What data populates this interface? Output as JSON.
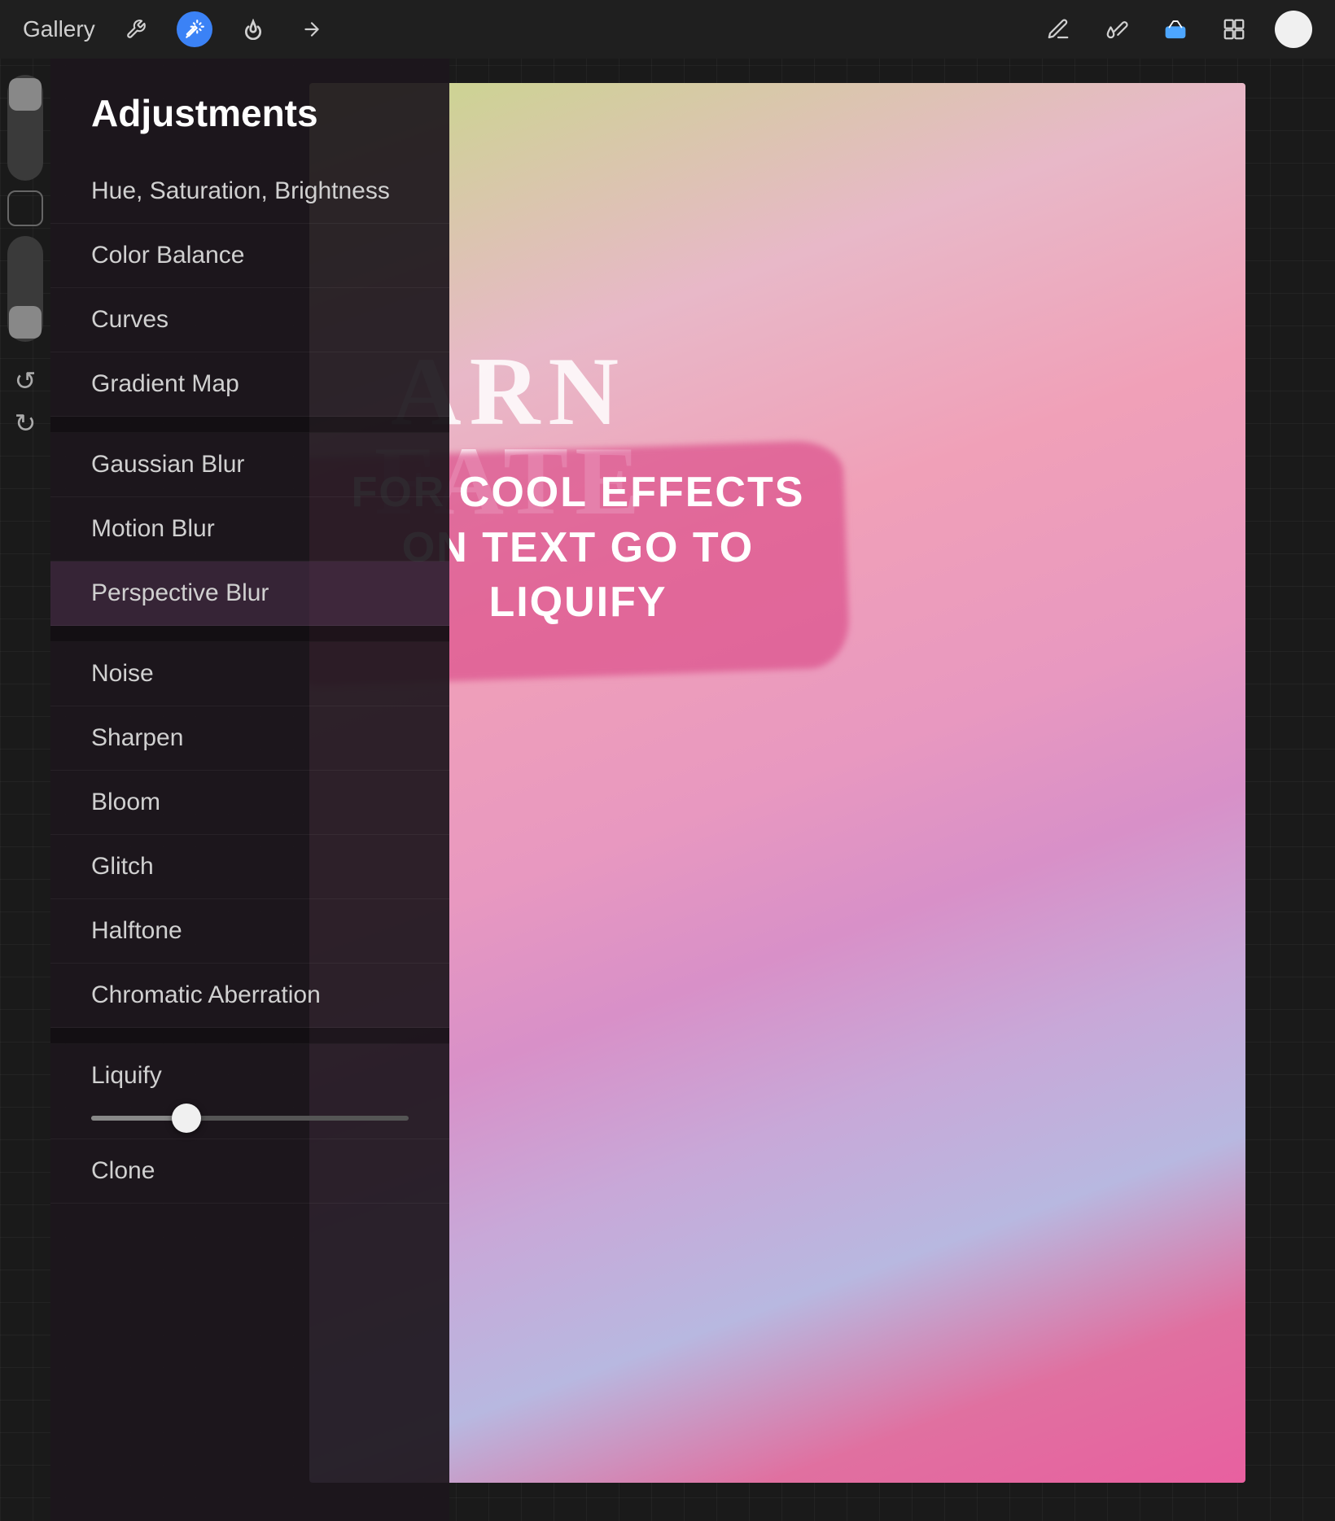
{
  "topBar": {
    "gallery": "Gallery",
    "icons": {
      "wrench": "wrench-icon",
      "magic": "magic-wand-icon",
      "style": "style-icon",
      "arrow": "arrow-icon"
    },
    "tools": {
      "pen": "pen-tool-icon",
      "brush": "brush-tool-icon",
      "eraser": "eraser-tool-icon",
      "layers": "layers-icon"
    }
  },
  "adjustments": {
    "title": "Adjustments",
    "items": [
      {
        "id": "hue-saturation",
        "label": "Hue, Saturation, Brightness",
        "section": "color"
      },
      {
        "id": "color-balance",
        "label": "Color Balance",
        "section": "color"
      },
      {
        "id": "curves",
        "label": "Curves",
        "section": "color"
      },
      {
        "id": "gradient-map",
        "label": "Gradient Map",
        "section": "color"
      },
      {
        "id": "gaussian-blur",
        "label": "Gaussian Blur",
        "section": "blur"
      },
      {
        "id": "motion-blur",
        "label": "Motion Blur",
        "section": "blur"
      },
      {
        "id": "perspective-blur",
        "label": "Perspective Blur",
        "section": "blur"
      },
      {
        "id": "noise",
        "label": "Noise",
        "section": "effects"
      },
      {
        "id": "sharpen",
        "label": "Sharpen",
        "section": "effects"
      },
      {
        "id": "bloom",
        "label": "Bloom",
        "section": "effects"
      },
      {
        "id": "glitch",
        "label": "Glitch",
        "section": "effects"
      },
      {
        "id": "halftone",
        "label": "Halftone",
        "section": "effects"
      },
      {
        "id": "chromatic-aberration",
        "label": "Chromatic Aberration",
        "section": "effects"
      },
      {
        "id": "liquify",
        "label": "Liquify",
        "section": "special",
        "hasSlider": true,
        "sliderValue": 30
      },
      {
        "id": "clone",
        "label": "Clone",
        "section": "special"
      }
    ]
  },
  "artwork": {
    "textArn": "ARN",
    "textFate": "FATE",
    "callToAction": "FOR COOL EFFECTS ON TEXT GO TO LIQUIFY"
  }
}
